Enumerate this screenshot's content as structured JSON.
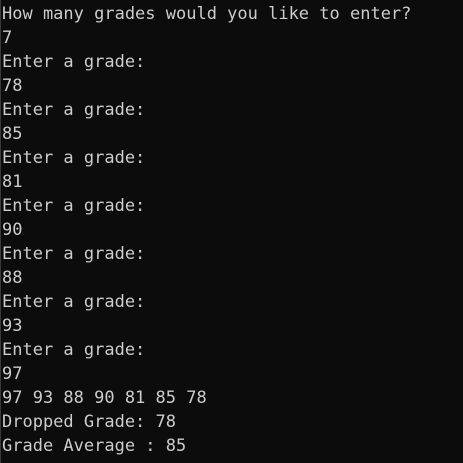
{
  "console": {
    "lines": [
      "How many grades would you like to enter?",
      "7",
      "Enter a grade:",
      "78",
      "Enter a grade:",
      "85",
      "Enter a grade:",
      "81",
      "Enter a grade:",
      "90",
      "Enter a grade:",
      "88",
      "Enter a grade:",
      "93",
      "Enter a grade:",
      "97",
      "97 93 88 90 81 85 78",
      "Dropped Grade: 78",
      "Grade Average : 85"
    ]
  },
  "colors": {
    "background": "#0c0c0c",
    "text": "#cccccc"
  }
}
